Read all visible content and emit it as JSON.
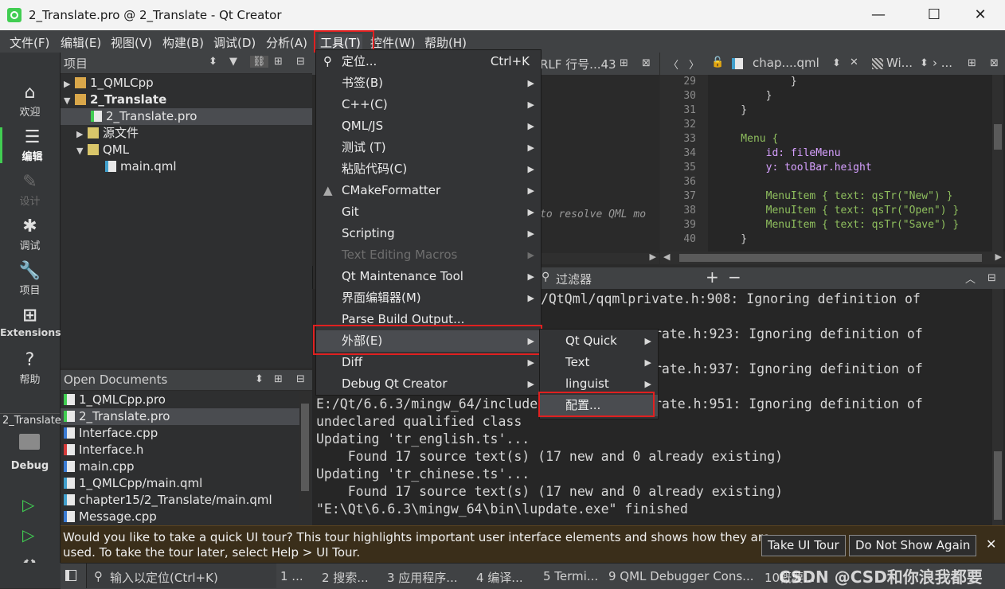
{
  "window": {
    "title": "2_Translate.pro @ 2_Translate - Qt Creator",
    "minimize": "—",
    "maximize": "☐",
    "close": "✕"
  },
  "menubar": [
    "文件(F)",
    "编辑(E)",
    "视图(V)",
    "构建(B)",
    "调试(D)",
    "分析(A)",
    "工具(T)",
    "控件(W)",
    "帮助(H)"
  ],
  "modes": [
    {
      "label": "欢迎",
      "icon": "home-icon",
      "glyph": "⌂"
    },
    {
      "label": "编辑",
      "icon": "edit-icon",
      "glyph": "☰"
    },
    {
      "label": "设计",
      "icon": "design-icon",
      "glyph": "✎"
    },
    {
      "label": "调试",
      "icon": "debug-icon",
      "glyph": "✱"
    },
    {
      "label": "项目",
      "icon": "projects-icon",
      "glyph": "🔧"
    },
    {
      "label": "Extensions",
      "icon": "extensions-icon",
      "glyph": "⊞"
    },
    {
      "label": "帮助",
      "icon": "help-icon",
      "glyph": "?"
    }
  ],
  "kit": {
    "project": "2_Translate",
    "config": "Debug"
  },
  "project_panel": {
    "title": "项目",
    "tree": [
      "1_QMLCpp",
      "2_Translate",
      "2_Translate.pro",
      "源文件",
      "QML",
      "main.qml"
    ]
  },
  "open_documents": {
    "title": "Open Documents",
    "items": [
      "1_QMLCpp.pro",
      "2_Translate.pro",
      "Interface.cpp",
      "Interface.h",
      "main.cpp",
      "1_QMLCpp/main.qml",
      "chapter15/2_Translate/main.qml",
      "Message.cpp"
    ]
  },
  "mid_editor": {
    "header_text": "RLF  行号...43",
    "hint": "to resolve QML mo"
  },
  "right_editor": {
    "file": "chap....qml",
    "symbol": "Wi...",
    "more": "› ...",
    "line_numbers": [
      "29",
      "30",
      "31",
      "32",
      "33",
      "34",
      "35",
      "36",
      "37",
      "38",
      "39",
      "40"
    ],
    "code": [
      "            }",
      "        }",
      "    }",
      "",
      "    Menu {",
      "        id: fileMenu",
      "        y: toolBar.height",
      "",
      "        MenuItem { text: qsTr(\"New\") }",
      "        MenuItem { text: qsTr(\"Open\") }",
      "        MenuItem { text: qsTr(\"Save\") }",
      "    }"
    ]
  },
  "output": {
    "filter_label": "过滤器",
    "lines": [
      "/QtQml/qqmlprivate.h:908: Ignoring definition of",
      "",
      "rate.h:923: Ignoring definition of",
      "",
      "rate.h:937: Ignoring definition of",
      "",
      "E:/Qt/6.6.3/mingw_64/include",
      "rate.h:951: Ignoring definition of",
      "undeclared qualified class",
      "Updating 'tr_english.ts'...",
      "    Found 17 source text(s) (17 new and 0 already existing)",
      "Updating 'tr_chinese.ts'...",
      "    Found 17 source text(s) (17 new and 0 already existing)",
      "\"E:\\Qt\\6.6.3\\mingw_64\\bin\\lupdate.exe\" finished"
    ]
  },
  "tools_menu": {
    "items": [
      {
        "label": "定位...",
        "shortcut": "Ctrl+K",
        "icon": "search-icon"
      },
      {
        "label": "书签(B)"
      },
      {
        "label": "C++(C)"
      },
      {
        "label": "QML/JS"
      },
      {
        "label": "测试 (T)"
      },
      {
        "label": "粘贴代码(C)"
      },
      {
        "label": "CMakeFormatter",
        "icon": "cmake-icon"
      },
      {
        "label": "Git"
      },
      {
        "label": "Scripting"
      },
      {
        "label": "Text Editing Macros",
        "disabled": true
      },
      {
        "label": "Qt Maintenance Tool"
      },
      {
        "label": "界面编辑器(M)"
      },
      {
        "label": "Parse Build Output..."
      },
      {
        "label": "外部(E)",
        "selected": true
      },
      {
        "label": "Diff"
      },
      {
        "label": "Debug Qt Creator"
      }
    ]
  },
  "external_submenu": {
    "items": [
      "Qt Quick",
      "Text",
      "linguist",
      "配置..."
    ]
  },
  "tour": {
    "message_1": "Would you like to take a quick UI tour? This tour highlights important user interface elements and shows how they are",
    "message_2": "used. To take the tour later, select Help > UI Tour.",
    "take": "Take UI Tour",
    "dismiss": "Do Not Show Again",
    "close": "✕"
  },
  "statusbar": {
    "locator_placeholder": "输入以定位(Ctrl+K)",
    "panes": [
      "1 ...",
      "2 搜索...",
      "3 应用程序...",
      "4 编译...",
      "5 Termi...",
      "9 QML Debugger Cons...",
      "10概要..."
    ],
    "watermark": "CSDN @CSD和你浪我都要"
  },
  "colors": {
    "accent_red": "#e02020",
    "qml_keyword": "#8fbf5e",
    "qml_id": "#d6a0ff"
  }
}
